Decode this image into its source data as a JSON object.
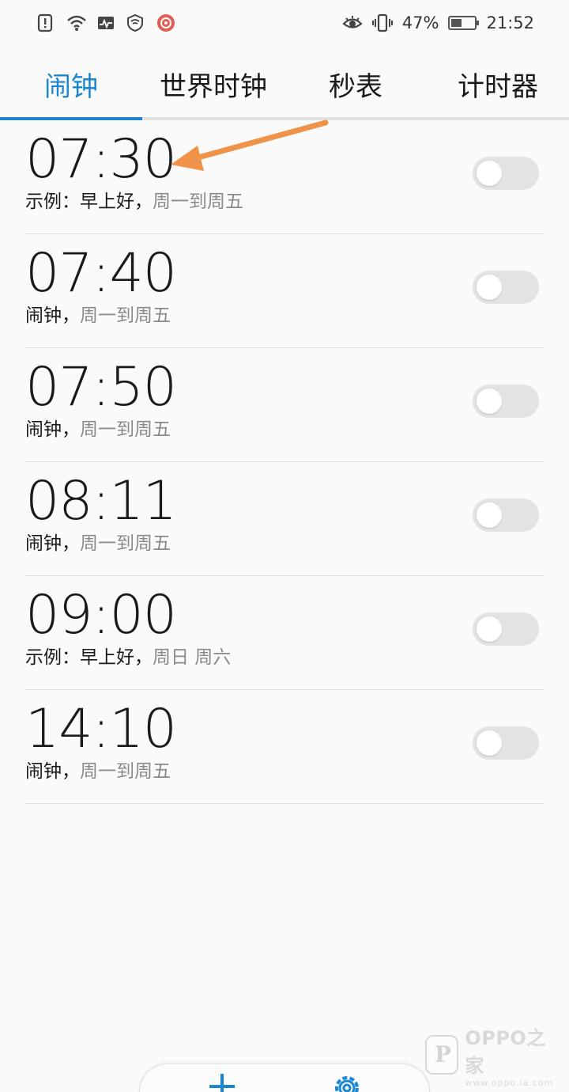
{
  "status_bar": {
    "left_icons": [
      "notification-alert-icon",
      "wifi-icon",
      "activity-monitor-icon",
      "shield-icon",
      "app-badge-icon"
    ],
    "right_icons": [
      "eye-comfort-icon",
      "vibrate-icon",
      "battery-icon"
    ],
    "battery_percent": "47%",
    "battery_level": 0.47,
    "time": "21:52"
  },
  "tabs": [
    {
      "label": "闹钟",
      "active": true
    },
    {
      "label": "世界时钟",
      "active": false
    },
    {
      "label": "秒表",
      "active": false
    },
    {
      "label": "计时器",
      "active": false
    }
  ],
  "alarms": [
    {
      "time": "07:30",
      "label": "示例：早上好，",
      "repeat": "周一到周五",
      "enabled": false
    },
    {
      "time": "07:40",
      "label": "闹钟，",
      "repeat": "周一到周五",
      "enabled": false
    },
    {
      "time": "07:50",
      "label": "闹钟，",
      "repeat": "周一到周五",
      "enabled": false
    },
    {
      "time": "08:11",
      "label": "闹钟，",
      "repeat": "周一到周五",
      "enabled": false
    },
    {
      "time": "09:00",
      "label": "示例：早上好，",
      "repeat": "周日 周六",
      "enabled": false
    },
    {
      "time": "14:10",
      "label": "闹钟，",
      "repeat": "周一到周五",
      "enabled": false
    }
  ],
  "bottom_bar": {
    "buttons": [
      "add-icon",
      "settings-icon"
    ]
  },
  "watermark": {
    "brand": "OPPO之家",
    "url": "www.oppo.la.com"
  },
  "colors": {
    "accent": "#1a86d0",
    "annotation_arrow": "#f0924a",
    "toggle_off": "#e3e3e3"
  }
}
